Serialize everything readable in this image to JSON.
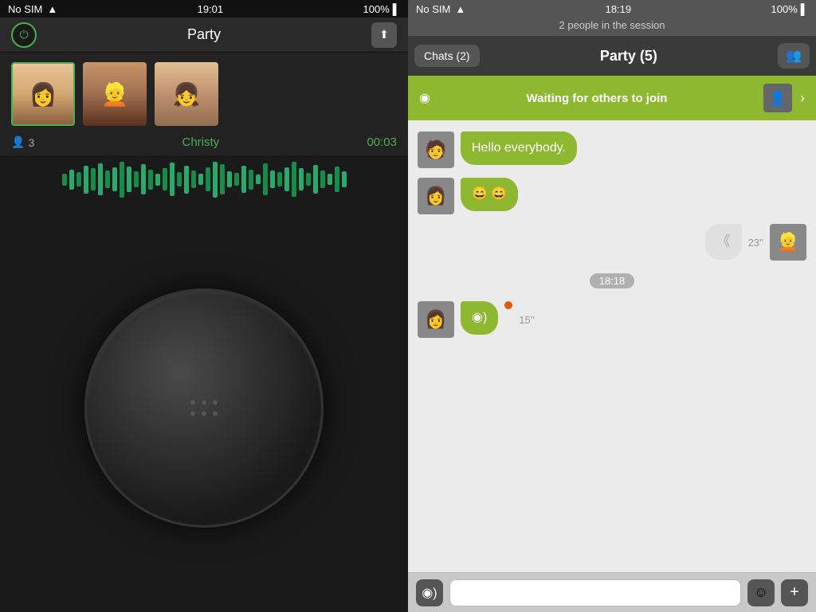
{
  "left": {
    "status_bar": {
      "carrier": "No SIM",
      "time": "19:01",
      "battery": "100%"
    },
    "nav": {
      "title": "Party",
      "power_label": "⏻",
      "upload_label": "⬆"
    },
    "participants": {
      "count": "3",
      "active_name": "Christy",
      "timer": "00:03"
    }
  },
  "right": {
    "status_bar": {
      "carrier": "No SIM",
      "time": "18:19",
      "battery": "100%"
    },
    "session_info": "2 people in the session",
    "nav": {
      "chats_label": "Chats (2)",
      "party_label": "Party  (5)"
    },
    "waiting_banner": {
      "text": "Waiting for others to join"
    },
    "messages": [
      {
        "type": "incoming",
        "text": "Hello everybody.",
        "avatar": "🧑"
      },
      {
        "type": "incoming",
        "text": "😄😄",
        "avatar": "👩"
      },
      {
        "type": "outgoing",
        "text": "",
        "time": "23''",
        "avatar": "👱"
      },
      {
        "type": "timestamp",
        "text": "18:18"
      },
      {
        "type": "incoming-voice",
        "text": "",
        "time": "15''",
        "avatar": "👩"
      }
    ],
    "input": {
      "placeholder": ""
    }
  }
}
